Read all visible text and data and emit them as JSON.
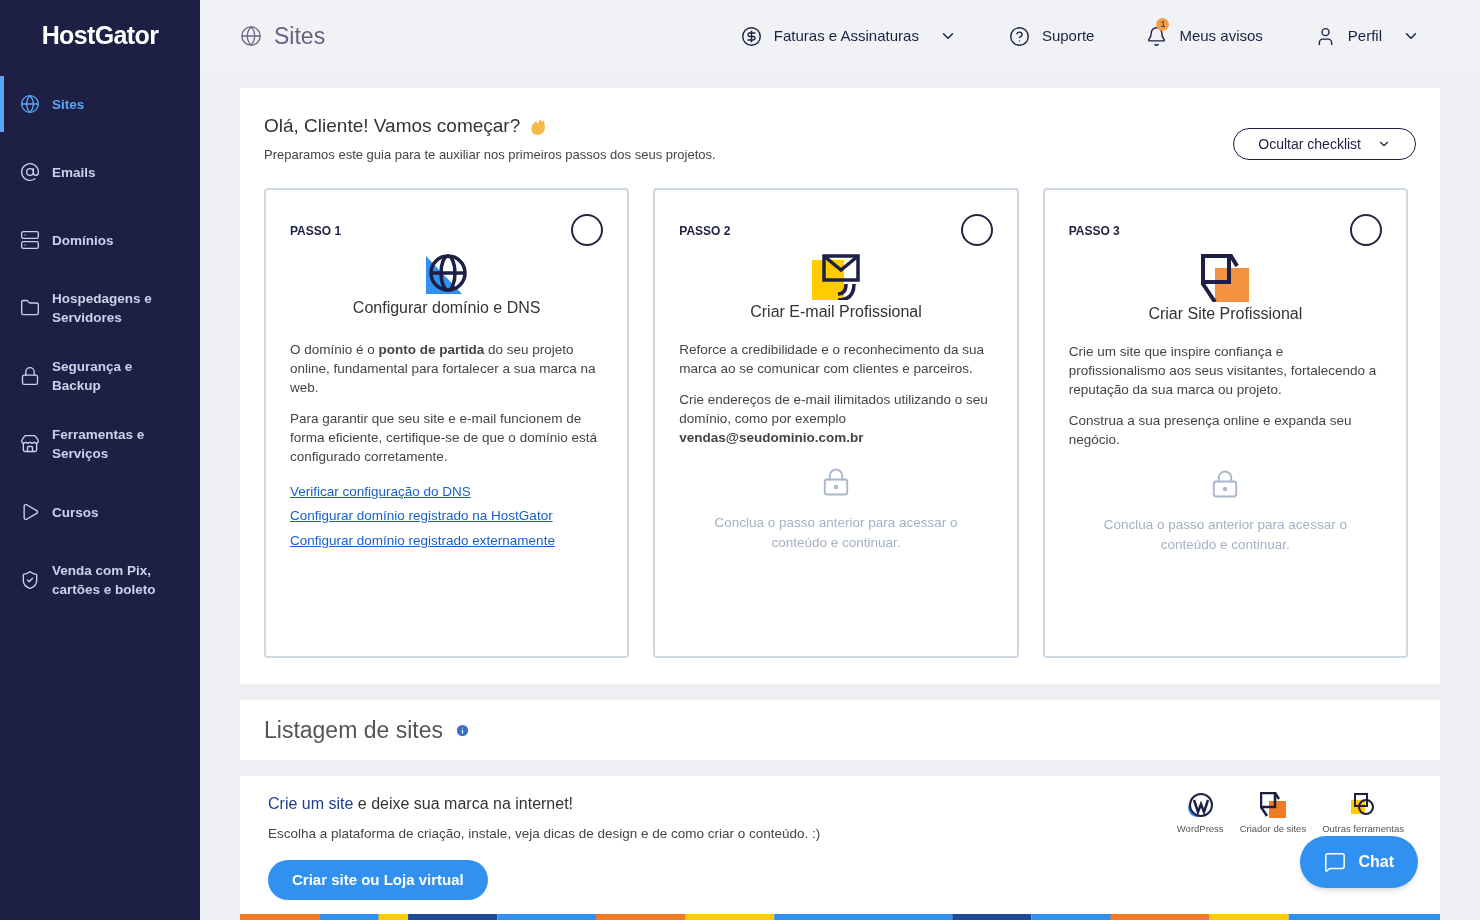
{
  "brand": "HostGator",
  "sidebar": {
    "items": [
      {
        "kind": "globe",
        "label": "Sites",
        "selected": true
      },
      {
        "kind": "at",
        "label": "Emails",
        "selected": false
      },
      {
        "kind": "server",
        "label": "Domínios",
        "selected": false
      },
      {
        "kind": "folder",
        "label": "Hospedagens e Servidores",
        "selected": false
      },
      {
        "kind": "lock",
        "label": "Segurança e Backup",
        "selected": false
      },
      {
        "kind": "store",
        "label": "Ferramentas e Serviços",
        "selected": false
      },
      {
        "kind": "play",
        "label": "Cursos",
        "selected": false
      },
      {
        "kind": "shield",
        "label": "Venda com Pix, cartões e boleto",
        "selected": false
      }
    ]
  },
  "header": {
    "title": "Sites",
    "nav": [
      {
        "kind": "dollar",
        "label": "Faturas e Assinaturas",
        "dropdown": true
      },
      {
        "kind": "help",
        "label": "Suporte",
        "dropdown": false
      },
      {
        "kind": "bell",
        "label": "Meus avisos",
        "dropdown": false,
        "badge": "1"
      },
      {
        "kind": "user",
        "label": "Perfil",
        "dropdown": true
      }
    ]
  },
  "checklist": {
    "title": "Olá, Cliente! Vamos começar?",
    "subtitle": "Preparamos este guia para te auxiliar nos primeiros passos dos seus projetos.",
    "hide_button": "Ocultar checklist",
    "steps": [
      {
        "kind": "open",
        "step": "PASSO 1",
        "title": "Configurar domínio e DNS",
        "checked": false,
        "paragraphs": [
          "O domínio é o **ponto de partida** do seu projeto online, fundamental para fortalecer a sua marca na web.",
          "Para garantir que seu site e e-mail funcionem de forma eficiente, certifique-se de que o domínio está configurado corretamente."
        ],
        "links": [
          "Verificar configuração do DNS",
          "Configurar domínio registrado na HostGator",
          "Configurar domínio registrado externamente"
        ]
      },
      {
        "kind": "locked",
        "step": "PASSO 2",
        "title": "Criar E-mail Profissional",
        "checked": false,
        "paragraphs": [
          "Reforce a credibilidade e o reconhecimento da sua marca ao se comunicar com clientes e parceiros.",
          "Crie endereços de e-mail ilimitados utilizando o seu domínio, como por exemplo **vendas@seudominio.com.br**"
        ],
        "locked_message": "Conclua o passo anterior para acessar o conteúdo e continuar."
      },
      {
        "kind": "locked",
        "step": "PASSO 3",
        "title": "Criar Site Profissional",
        "checked": false,
        "paragraphs": [
          "Crie um site que inspire confiança e profissionalismo aos seus visitantes, fortalecendo a reputação da sua marca ou projeto.",
          "Construa a sua presença online e expanda seu negócio."
        ],
        "locked_message": "Conclua o passo anterior para acessar o conteúdo e continuar."
      }
    ]
  },
  "listing": {
    "title": "Listagem de sites"
  },
  "promo": {
    "headline_highlight": "Crie um site",
    "headline_rest": "e deixe sua marca na internet!",
    "description": "Escolha a plataforma de criação, instale, veja dicas de design e de como criar o conteúdo. :)",
    "button": "Criar site ou Loja virtual",
    "platforms": [
      {
        "kind": "wordpress",
        "label": "WordPress"
      },
      {
        "kind": "builder",
        "label": "Criador de sites"
      },
      {
        "kind": "tools",
        "label": "Outras ferramentas"
      }
    ]
  },
  "chat": {
    "label": "Chat"
  }
}
